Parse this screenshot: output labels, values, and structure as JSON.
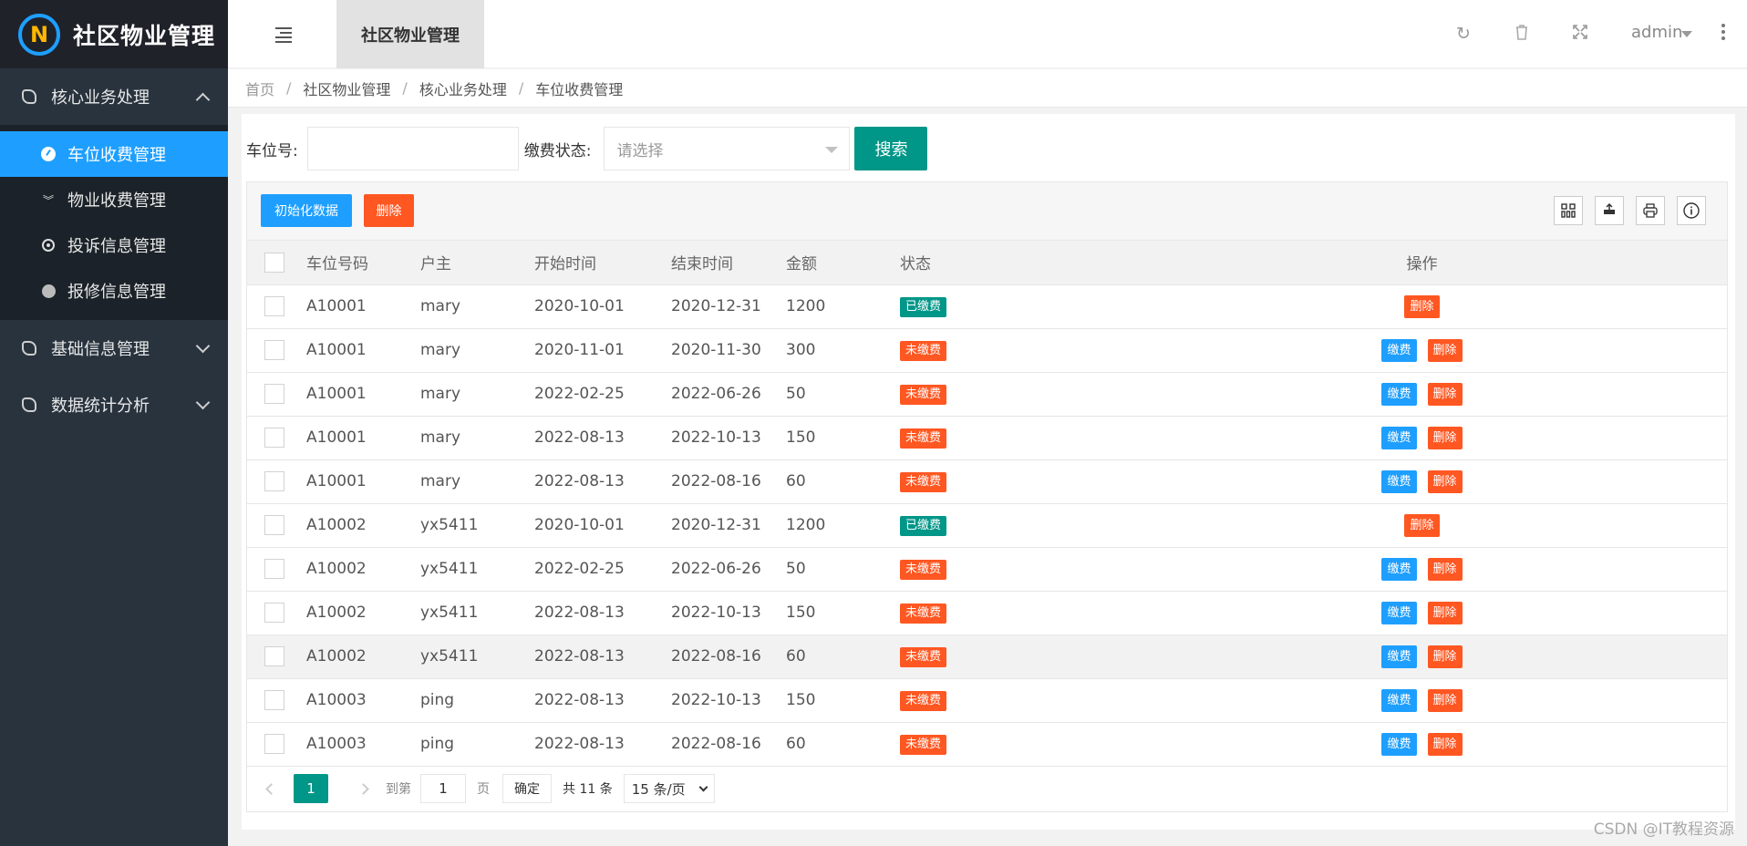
{
  "app": {
    "title": "社区物业管理",
    "logo_letter": "N"
  },
  "sidebar": {
    "groups": [
      {
        "label": "核心业务处理",
        "expanded": true
      },
      {
        "label": "基础信息管理",
        "expanded": false
      },
      {
        "label": "数据统计分析",
        "expanded": false
      }
    ],
    "sub_items": [
      {
        "label": "车位收费管理",
        "icon": "dashboard-icon",
        "active": true
      },
      {
        "label": "物业收费管理",
        "icon": "double-chevron-down-icon",
        "active": false
      },
      {
        "label": "投诉信息管理",
        "icon": "target-icon",
        "active": false
      },
      {
        "label": "报修信息管理",
        "icon": "circle-icon",
        "active": false
      }
    ]
  },
  "header": {
    "tab_label": "社区物业管理",
    "user": "admin"
  },
  "breadcrumb": [
    "首页",
    "社区物业管理",
    "核心业务处理",
    "车位收费管理"
  ],
  "search": {
    "plate_label": "车位号:",
    "plate_value": "",
    "status_label": "缴费状态:",
    "status_placeholder": "请选择",
    "search_button": "搜索"
  },
  "toolbar": {
    "init_button": "初始化数据",
    "delete_button": "删除",
    "icons": [
      "columns-icon",
      "export-icon",
      "print-icon",
      "info-icon"
    ]
  },
  "table": {
    "columns": [
      "车位号码",
      "户主",
      "开始时间",
      "结束时间",
      "金额",
      "状态",
      "操作"
    ],
    "pay_label": "缴费",
    "delete_label": "删除",
    "rows": [
      {
        "code": "A10001",
        "owner": "mary",
        "start": "2020-10-01",
        "end": "2020-12-31",
        "amount": "1200",
        "status": "已缴费",
        "paid": true
      },
      {
        "code": "A10001",
        "owner": "mary",
        "start": "2020-11-01",
        "end": "2020-11-30",
        "amount": "300",
        "status": "未缴费",
        "paid": false
      },
      {
        "code": "A10001",
        "owner": "mary",
        "start": "2022-02-25",
        "end": "2022-06-26",
        "amount": "50",
        "status": "未缴费",
        "paid": false
      },
      {
        "code": "A10001",
        "owner": "mary",
        "start": "2022-08-13",
        "end": "2022-10-13",
        "amount": "150",
        "status": "未缴费",
        "paid": false
      },
      {
        "code": "A10001",
        "owner": "mary",
        "start": "2022-08-13",
        "end": "2022-08-16",
        "amount": "60",
        "status": "未缴费",
        "paid": false
      },
      {
        "code": "A10002",
        "owner": "yx5411",
        "start": "2020-10-01",
        "end": "2020-12-31",
        "amount": "1200",
        "status": "已缴费",
        "paid": true
      },
      {
        "code": "A10002",
        "owner": "yx5411",
        "start": "2022-02-25",
        "end": "2022-06-26",
        "amount": "50",
        "status": "未缴费",
        "paid": false
      },
      {
        "code": "A10002",
        "owner": "yx5411",
        "start": "2022-08-13",
        "end": "2022-10-13",
        "amount": "150",
        "status": "未缴费",
        "paid": false
      },
      {
        "code": "A10002",
        "owner": "yx5411",
        "start": "2022-08-13",
        "end": "2022-08-16",
        "amount": "60",
        "status": "未缴费",
        "paid": false,
        "highlight": true
      },
      {
        "code": "A10003",
        "owner": "ping",
        "start": "2022-08-13",
        "end": "2022-10-13",
        "amount": "150",
        "status": "未缴费",
        "paid": false
      },
      {
        "code": "A10003",
        "owner": "ping",
        "start": "2022-08-13",
        "end": "2022-08-16",
        "amount": "60",
        "status": "未缴费",
        "paid": false
      }
    ]
  },
  "pager": {
    "current": "1",
    "goto_label": "到第",
    "goto_value": "1",
    "page_unit": "页",
    "confirm": "确定",
    "total": "共 11 条",
    "page_size": "15 条/页"
  },
  "watermark": "CSDN @IT教程资源",
  "colors": {
    "sidebar_bg": "#28333e",
    "active_blue": "#1e9fff",
    "primary_green": "#009688",
    "danger_orange": "#ff5722"
  }
}
